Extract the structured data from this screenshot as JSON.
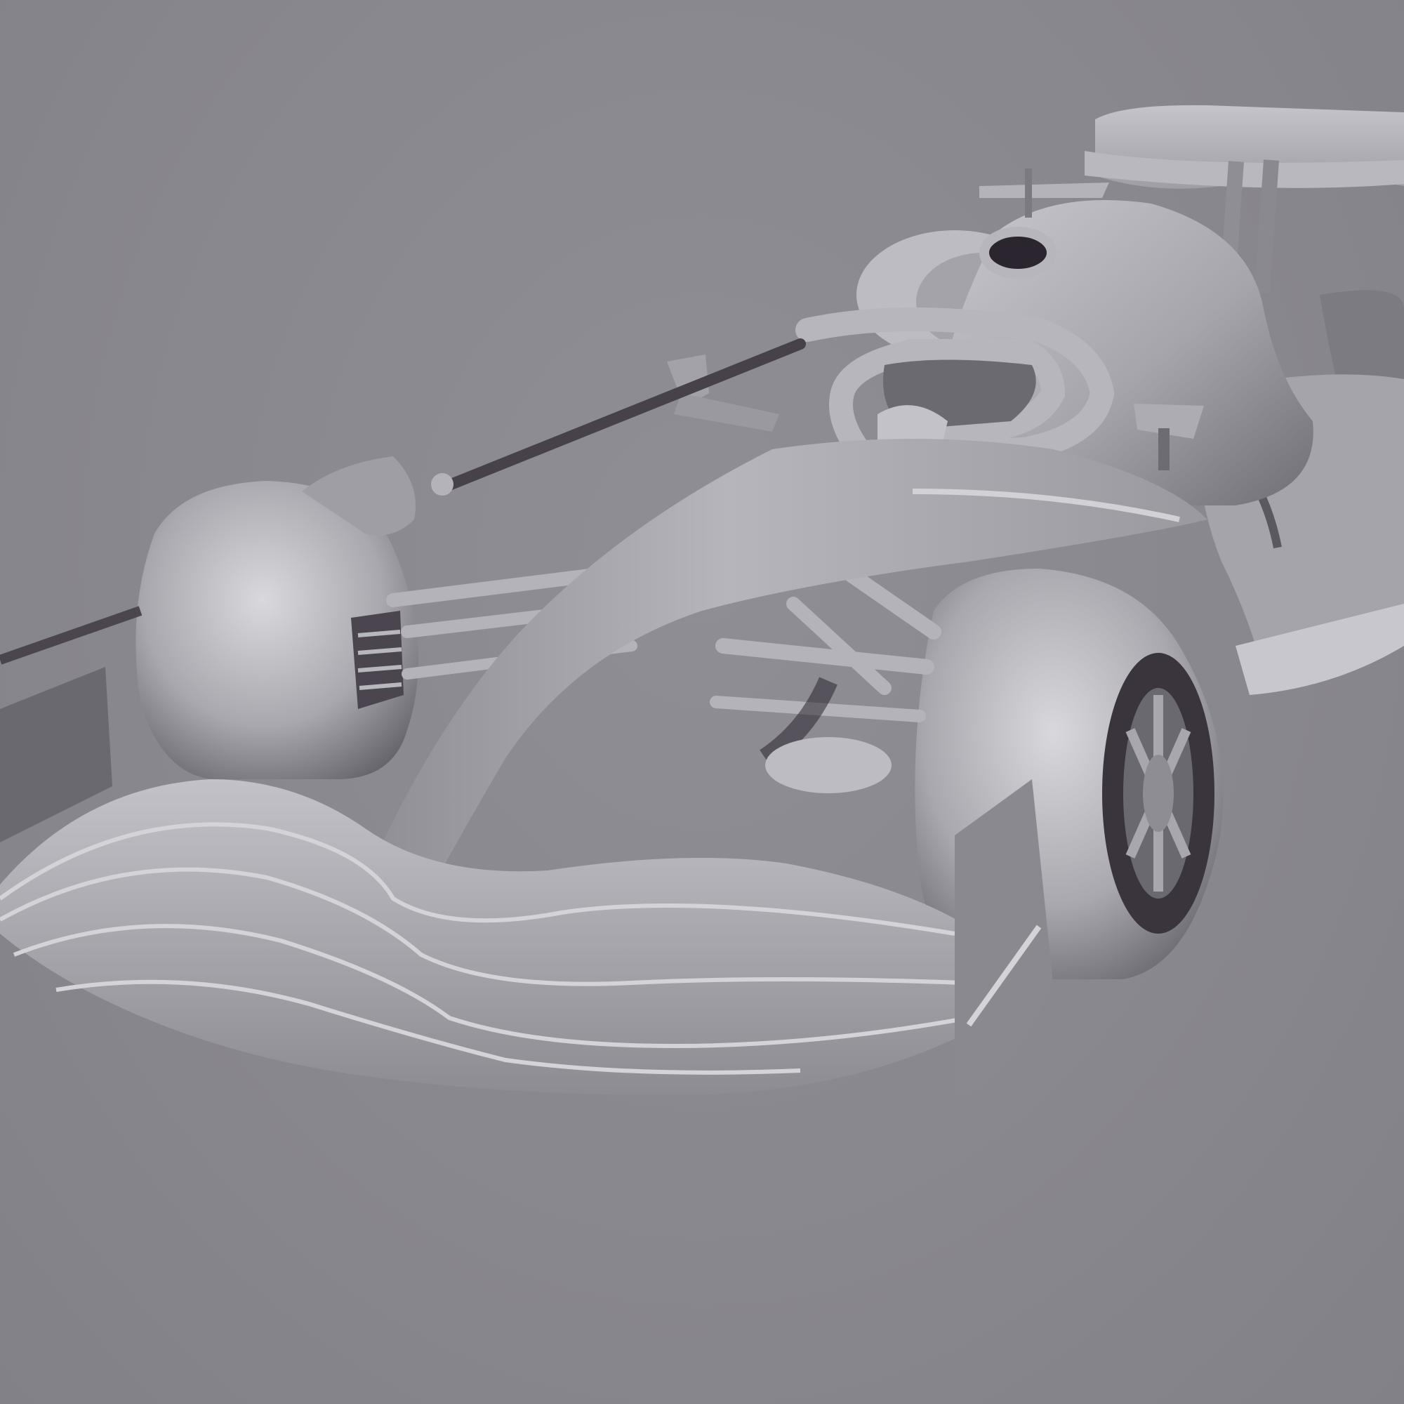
{
  "scene": {
    "subject": "race-car-3d-model",
    "render_style": "grey clay render",
    "colors": {
      "background": "#8a898f",
      "body_light": "#d2d1d6",
      "body_mid": "#a9a8ae",
      "body_dark": "#5d5c63",
      "shadow": "#1f1a22"
    }
  }
}
